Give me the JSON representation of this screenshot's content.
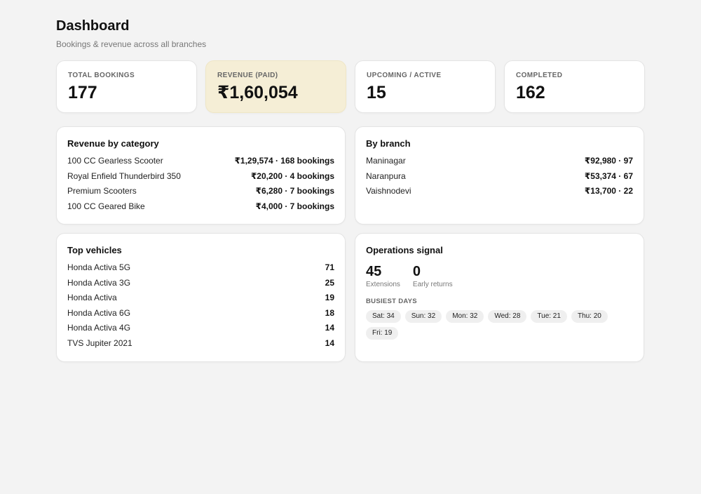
{
  "header": {
    "title": "Dashboard",
    "subtitle": "Bookings & revenue across all branches"
  },
  "stats": [
    {
      "label": "TOTAL BOOKINGS",
      "value": "177"
    },
    {
      "label": "REVENUE (PAID)",
      "value": "₹1,60,054"
    },
    {
      "label": "UPCOMING / ACTIVE",
      "value": "15"
    },
    {
      "label": "COMPLETED",
      "value": "162"
    }
  ],
  "revenue_by_category": {
    "title": "Revenue by category",
    "rows": [
      {
        "name": "100 CC Gearless Scooter",
        "value": "₹1,29,574 · 168 bookings"
      },
      {
        "name": "Royal Enfield Thunderbird 350",
        "value": "₹20,200 · 4 bookings"
      },
      {
        "name": "Premium Scooters",
        "value": "₹6,280 · 7 bookings"
      },
      {
        "name": "100 CC Geared Bike",
        "value": "₹4,000 · 7 bookings"
      }
    ]
  },
  "by_branch": {
    "title": "By branch",
    "rows": [
      {
        "name": "Maninagar",
        "value": "₹92,980 · 97"
      },
      {
        "name": "Naranpura",
        "value": "₹53,374 · 67"
      },
      {
        "name": "Vaishnodevi",
        "value": "₹13,700 · 22"
      }
    ]
  },
  "top_vehicles": {
    "title": "Top vehicles",
    "rows": [
      {
        "name": "Honda Activa 5G",
        "value": "71"
      },
      {
        "name": "Honda Activa 3G",
        "value": "25"
      },
      {
        "name": "Honda Activa",
        "value": "19"
      },
      {
        "name": "Honda Activa 6G",
        "value": "18"
      },
      {
        "name": "Honda Activa 4G",
        "value": "14"
      },
      {
        "name": "TVS Jupiter 2021",
        "value": "14"
      }
    ]
  },
  "operations": {
    "title": "Operations signal",
    "metrics": [
      {
        "value": "45",
        "label": "Extensions"
      },
      {
        "value": "0",
        "label": "Early returns"
      }
    ],
    "busiest_label": "BUSIEST DAYS",
    "busiest_days": [
      "Sat: 34",
      "Sun: 32",
      "Mon: 32",
      "Wed: 28",
      "Tue: 21",
      "Thu: 20",
      "Fri: 19"
    ]
  },
  "colors": {
    "background": "#f3f3f3",
    "card": "#ffffff",
    "highlight_card": "#f5eed6"
  }
}
